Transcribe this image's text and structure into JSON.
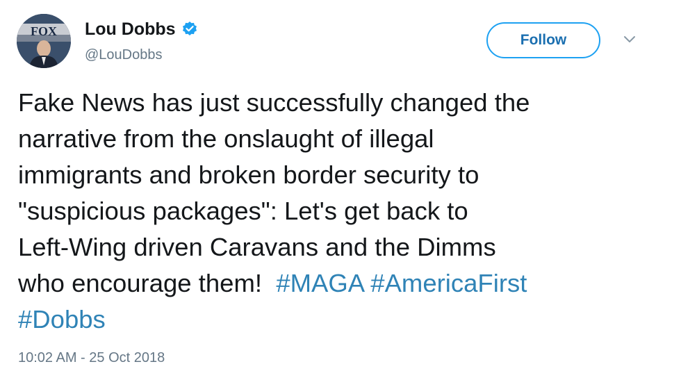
{
  "author": {
    "display_name": "Lou Dobbs",
    "handle": "@LouDobbs",
    "avatar_text": "FOX",
    "verified": true
  },
  "follow_button": {
    "label": "Follow"
  },
  "tweet": {
    "lines": [
      "Fake News has just successfully changed the",
      "narrative from the onslaught of illegal",
      "immigrants and broken border security to",
      "\"suspicious packages\": Let's get back to",
      "Left-Wing driven Caravans and the Dimms",
      "who encourage them!"
    ],
    "hashtags": [
      "#MAGA",
      "#AmericaFirst",
      "#Dobbs"
    ]
  },
  "timestamp": "10:02 AM - 25 Oct 2018",
  "colors": {
    "link": "#2f83b6",
    "follow_border": "#1da1f2",
    "verified": "#1da1f2",
    "secondary_text": "#657786"
  }
}
